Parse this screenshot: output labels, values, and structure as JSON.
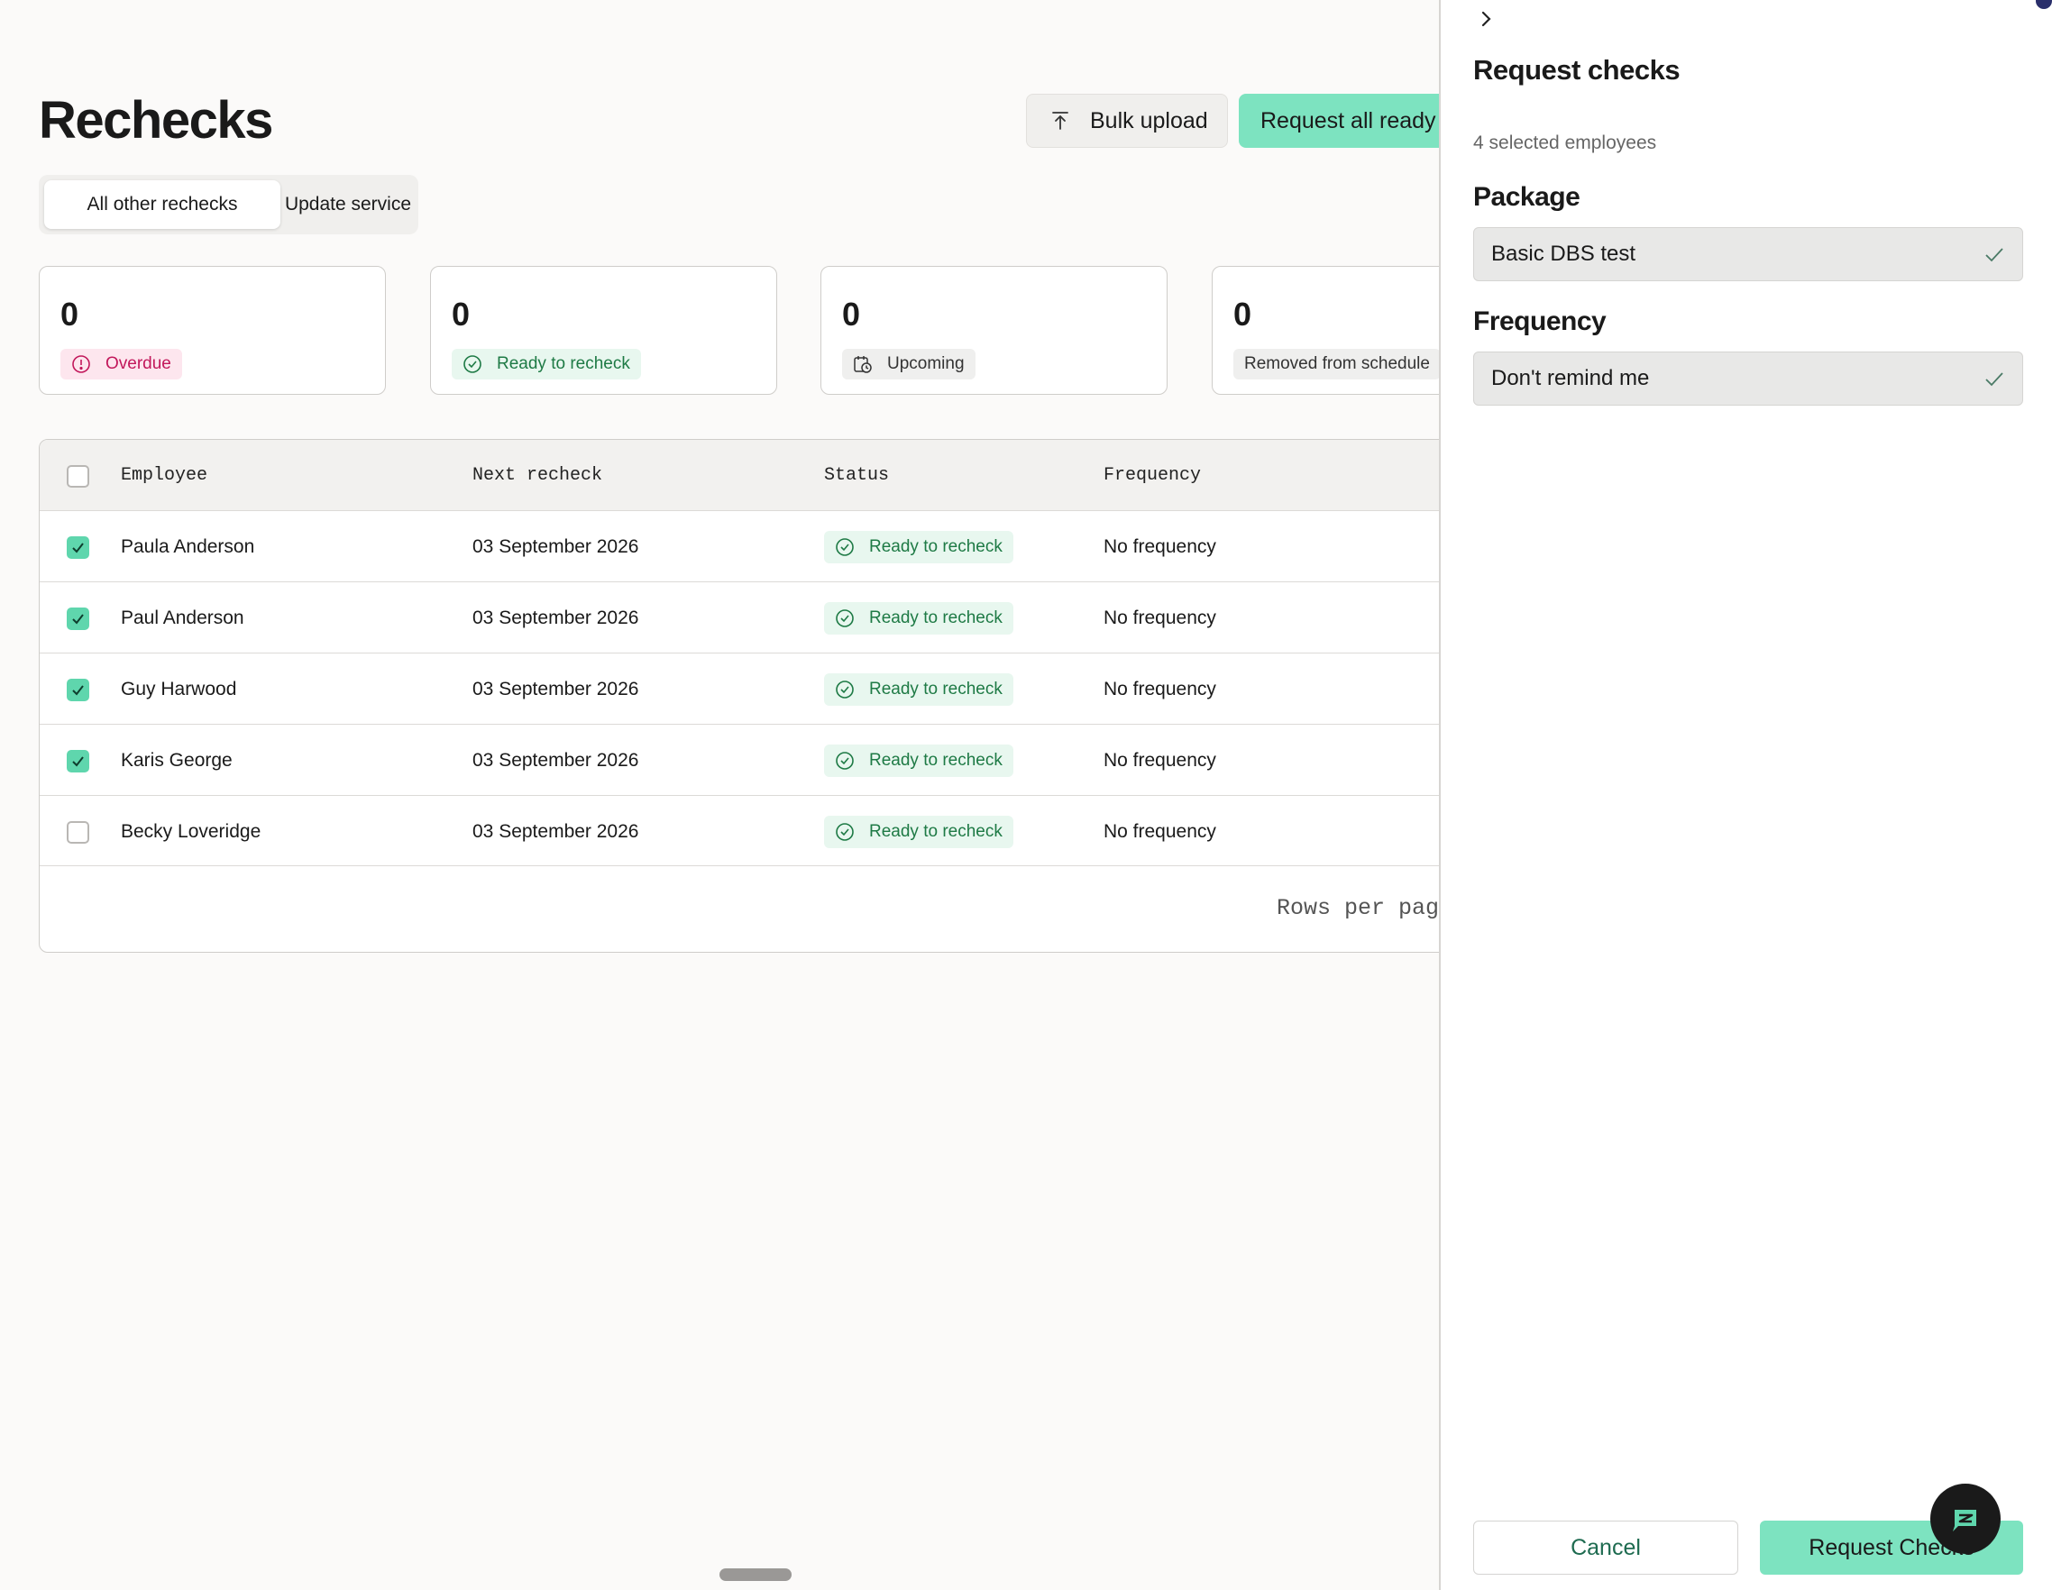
{
  "page": {
    "title": "Rechecks",
    "bulk_upload_label": "Bulk upload",
    "request_all_label": "Request all ready to recheck"
  },
  "tabs": [
    {
      "label": "All other rechecks",
      "active": true
    },
    {
      "label": "Update service",
      "active": false
    }
  ],
  "stats": [
    {
      "count": "0",
      "label": "Overdue",
      "icon": "alert-circle-icon"
    },
    {
      "count": "0",
      "label": "Ready to recheck",
      "icon": "check-circle-icon"
    },
    {
      "count": "0",
      "label": "Upcoming",
      "icon": "calendar-clock-icon"
    },
    {
      "count": "0",
      "label": "Removed from schedule",
      "icon": ""
    }
  ],
  "table": {
    "columns": [
      "Employee",
      "Next recheck",
      "Status",
      "Frequency"
    ],
    "rows": [
      {
        "employee": "Paula Anderson",
        "next_recheck": "03 September 2026",
        "status": "Ready to recheck",
        "frequency": "No frequency",
        "selected": true
      },
      {
        "employee": "Paul Anderson",
        "next_recheck": "03 September 2026",
        "status": "Ready to recheck",
        "frequency": "No frequency",
        "selected": true
      },
      {
        "employee": "Guy Harwood",
        "next_recheck": "03 September 2026",
        "status": "Ready to recheck",
        "frequency": "No frequency",
        "selected": true
      },
      {
        "employee": "Karis George",
        "next_recheck": "03 September 2026",
        "status": "Ready to recheck",
        "frequency": "No frequency",
        "selected": true
      },
      {
        "employee": "Becky Loveridge",
        "next_recheck": "03 September 2026",
        "status": "Ready to recheck",
        "frequency": "No frequency",
        "selected": false
      }
    ],
    "rows_per_page_label": "Rows per page"
  },
  "panel": {
    "title": "Request checks",
    "subtitle": "4 selected employees",
    "package_label": "Package",
    "package_value": "Basic DBS test",
    "frequency_label": "Frequency",
    "frequency_value": "Don't remind me",
    "cancel_label": "Cancel",
    "submit_label": "Request Checks"
  },
  "colors": {
    "accent": "#7de3c0",
    "checkbox_checked": "#5fd6ad",
    "status_green": "#1e7a45",
    "overdue_red": "#c2185b"
  }
}
